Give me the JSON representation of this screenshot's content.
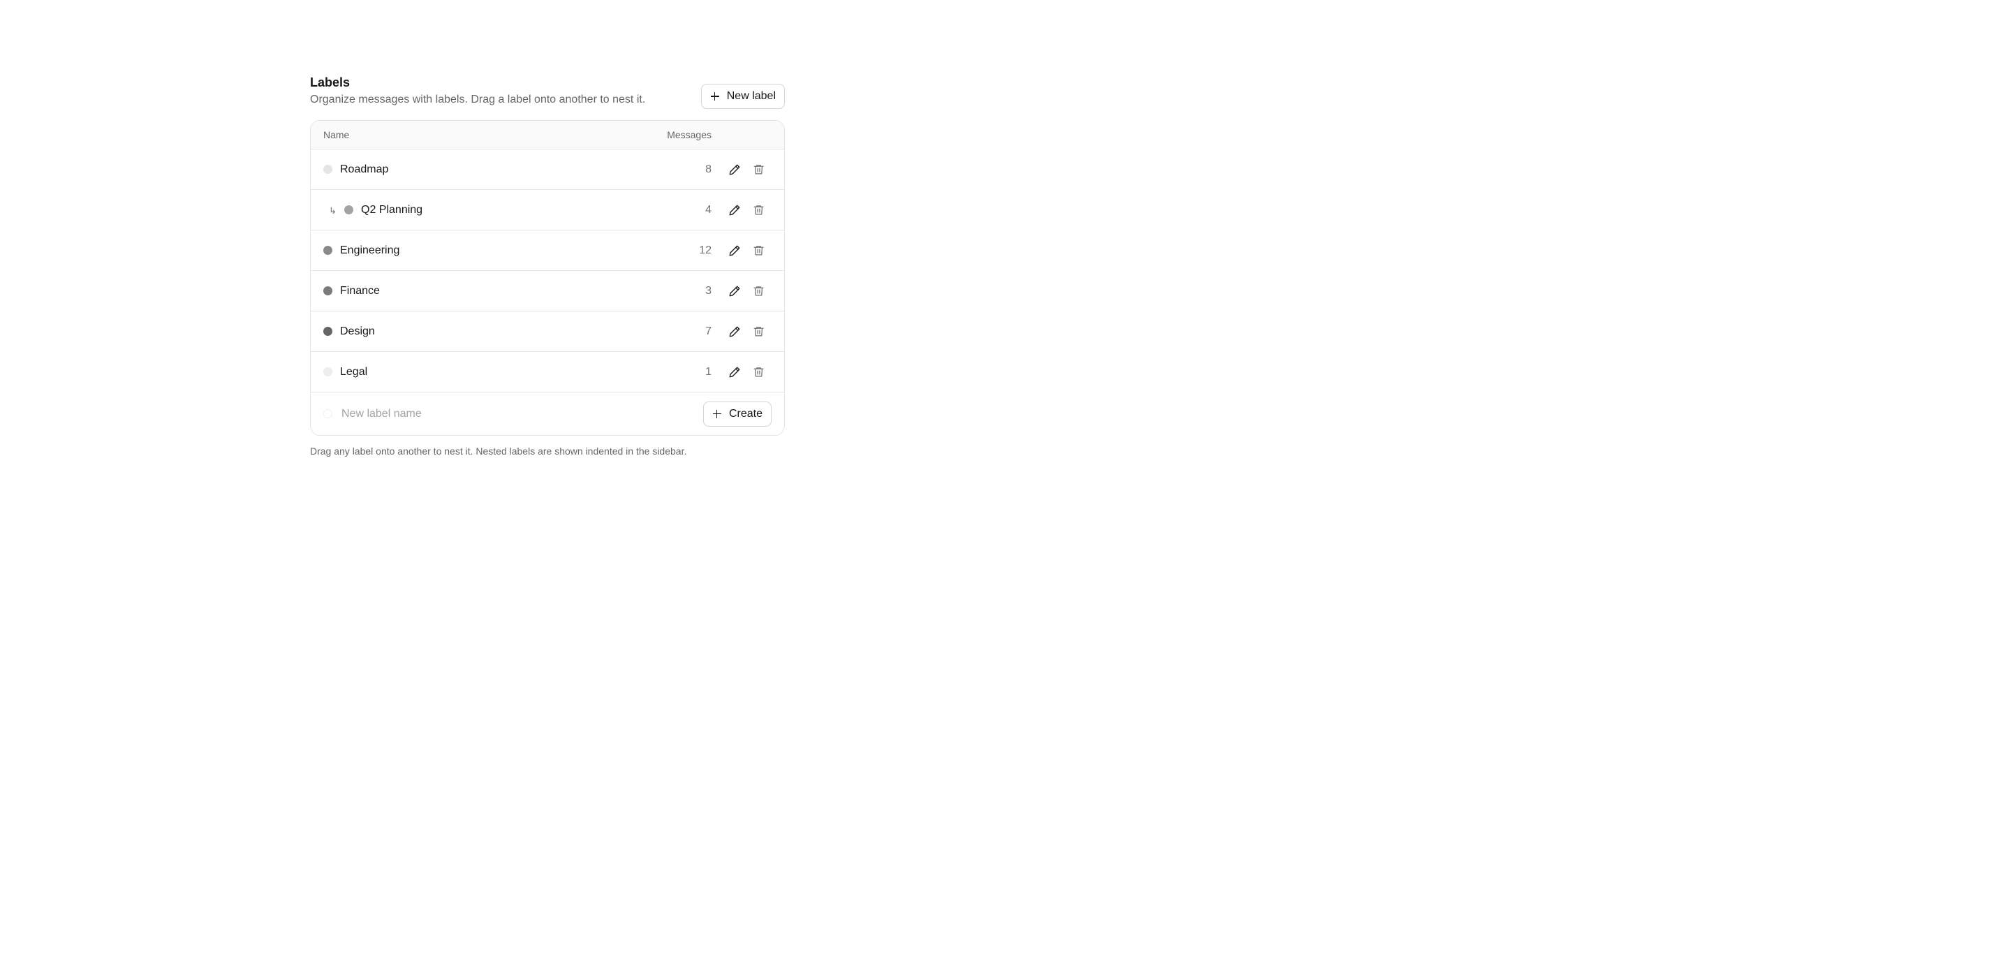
{
  "header": {
    "title": "Labels",
    "subtitle": "Organize messages with labels. Drag a label onto another to nest it.",
    "new_label_button": "New label"
  },
  "table": {
    "col_name": "Name",
    "col_messages": "Messages",
    "rows": [
      {
        "name": "Roadmap",
        "count": "8",
        "color": "#e5e5e5",
        "nested": false
      },
      {
        "name": "Q2 Planning",
        "count": "4",
        "color": "#a3a3a3",
        "nested": true,
        "nest_arrow": "↳"
      },
      {
        "name": "Engineering",
        "count": "12",
        "color": "#8a8a8a",
        "nested": false
      },
      {
        "name": "Finance",
        "count": "3",
        "color": "#7a7a7a",
        "nested": false
      },
      {
        "name": "Design",
        "count": "7",
        "color": "#666666",
        "nested": false
      },
      {
        "name": "Legal",
        "count": "1",
        "color": "#ededed",
        "nested": false
      }
    ]
  },
  "create_row": {
    "placeholder": "New label name",
    "create_button": "Create"
  },
  "footnote": "Drag any label onto another to nest it. Nested labels are shown indented in the sidebar.",
  "icons": {
    "edit": "pencil-icon",
    "delete": "trash-icon",
    "add": "plus-icon"
  }
}
